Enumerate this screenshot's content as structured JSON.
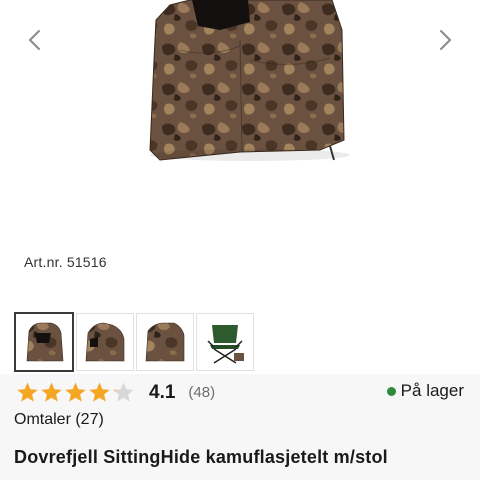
{
  "carousel": {
    "prev_icon": "chevron-left-icon",
    "next_icon": "chevron-right-icon"
  },
  "product": {
    "art_nr": "Art.nr. 51516",
    "title": "Dovrefjell SittingHide kamuflasjetelt m/stol",
    "rating_value": "4.1",
    "rating_fraction": 0.82,
    "rating_count": "(48)",
    "reviews_label": "Omtaler (27)",
    "stock_label": "På lager"
  },
  "thumbnails": [
    {
      "name": "thumbnail-front",
      "active": true
    },
    {
      "name": "thumbnail-side",
      "active": false
    },
    {
      "name": "thumbnail-back",
      "active": false
    },
    {
      "name": "thumbnail-chair",
      "active": false
    }
  ],
  "colors": {
    "star": "#f5a623",
    "star_empty": "#d8d8d8",
    "stock_dot": "#2f8a3c",
    "camo_base": "#6b5240"
  }
}
